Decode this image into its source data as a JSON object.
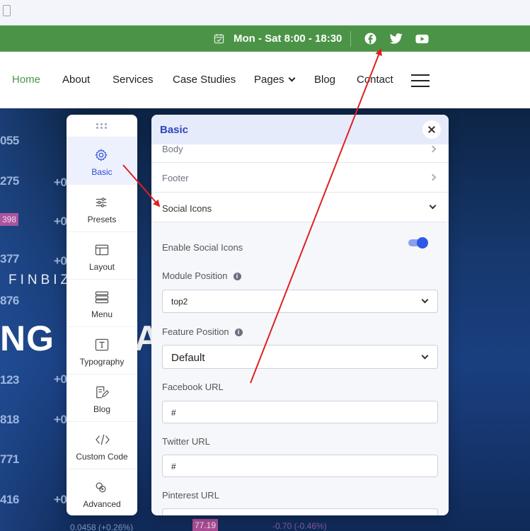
{
  "topbar": {
    "hours": "Mon - Sat 8:00 - 18:30",
    "social": [
      "facebook-icon",
      "twitter-icon",
      "youtube-icon"
    ]
  },
  "nav": {
    "items": [
      "Home",
      "About",
      "Services",
      "Case Studies",
      "Pages",
      "Blog",
      "Contact"
    ],
    "accent": "#4b9447"
  },
  "hero": {
    "tagline": "FINBIZ",
    "headline": "NG",
    "headline_tail": "A",
    "ticker_numbers": [
      "055",
      "275",
      "377",
      "876",
      "123",
      "818",
      "771",
      "416",
      "+0.",
      "+0.",
      "+0.",
      "+0.",
      "+0.",
      "+0."
    ],
    "ticker_tags": [
      "398",
      "-0.70 (-0.46%)",
      "0.0458 (+0.26%)",
      "77.19"
    ]
  },
  "side_menu": {
    "items": [
      {
        "label": "Basic",
        "icon": "gear-icon"
      },
      {
        "label": "Presets",
        "icon": "sliders-icon"
      },
      {
        "label": "Layout",
        "icon": "layout-icon"
      },
      {
        "label": "Menu",
        "icon": "menu-icon"
      },
      {
        "label": "Typography",
        "icon": "typography-icon"
      },
      {
        "label": "Blog",
        "icon": "blog-icon"
      },
      {
        "label": "Custom Code",
        "icon": "code-icon"
      },
      {
        "label": "Advanced",
        "icon": "advanced-icon"
      }
    ],
    "active": "Basic"
  },
  "panel": {
    "title": "Basic",
    "sections": [
      "Body",
      "Footer",
      "Social Icons"
    ],
    "open_section": "Social Icons",
    "enable_social_icons": {
      "label": "Enable Social Icons",
      "enabled": true
    },
    "module_position": {
      "label": "Module Position",
      "value": "top2"
    },
    "feature_position": {
      "label": "Feature Position",
      "value": "Default"
    },
    "facebook_url": {
      "label": "Facebook URL",
      "value": "#"
    },
    "twitter_url": {
      "label": "Twitter URL",
      "value": "#"
    },
    "pinterest_url": {
      "label": "Pinterest URL",
      "value": ""
    }
  },
  "colors": {
    "annotation_arrow": "#e02020",
    "panel_accent": "#2f57e8"
  }
}
